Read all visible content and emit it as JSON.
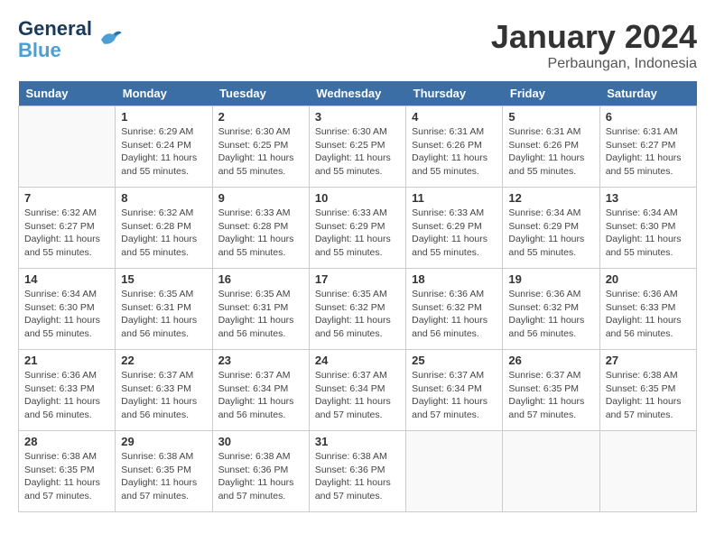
{
  "header": {
    "logo_line1": "General",
    "logo_line2": "Blue",
    "month": "January 2024",
    "location": "Perbaungan, Indonesia"
  },
  "weekdays": [
    "Sunday",
    "Monday",
    "Tuesday",
    "Wednesday",
    "Thursday",
    "Friday",
    "Saturday"
  ],
  "weeks": [
    [
      {
        "day": "",
        "info": ""
      },
      {
        "day": "1",
        "info": "Sunrise: 6:29 AM\nSunset: 6:24 PM\nDaylight: 11 hours\nand 55 minutes."
      },
      {
        "day": "2",
        "info": "Sunrise: 6:30 AM\nSunset: 6:25 PM\nDaylight: 11 hours\nand 55 minutes."
      },
      {
        "day": "3",
        "info": "Sunrise: 6:30 AM\nSunset: 6:25 PM\nDaylight: 11 hours\nand 55 minutes."
      },
      {
        "day": "4",
        "info": "Sunrise: 6:31 AM\nSunset: 6:26 PM\nDaylight: 11 hours\nand 55 minutes."
      },
      {
        "day": "5",
        "info": "Sunrise: 6:31 AM\nSunset: 6:26 PM\nDaylight: 11 hours\nand 55 minutes."
      },
      {
        "day": "6",
        "info": "Sunrise: 6:31 AM\nSunset: 6:27 PM\nDaylight: 11 hours\nand 55 minutes."
      }
    ],
    [
      {
        "day": "7",
        "info": "Sunrise: 6:32 AM\nSunset: 6:27 PM\nDaylight: 11 hours\nand 55 minutes."
      },
      {
        "day": "8",
        "info": "Sunrise: 6:32 AM\nSunset: 6:28 PM\nDaylight: 11 hours\nand 55 minutes."
      },
      {
        "day": "9",
        "info": "Sunrise: 6:33 AM\nSunset: 6:28 PM\nDaylight: 11 hours\nand 55 minutes."
      },
      {
        "day": "10",
        "info": "Sunrise: 6:33 AM\nSunset: 6:29 PM\nDaylight: 11 hours\nand 55 minutes."
      },
      {
        "day": "11",
        "info": "Sunrise: 6:33 AM\nSunset: 6:29 PM\nDaylight: 11 hours\nand 55 minutes."
      },
      {
        "day": "12",
        "info": "Sunrise: 6:34 AM\nSunset: 6:29 PM\nDaylight: 11 hours\nand 55 minutes."
      },
      {
        "day": "13",
        "info": "Sunrise: 6:34 AM\nSunset: 6:30 PM\nDaylight: 11 hours\nand 55 minutes."
      }
    ],
    [
      {
        "day": "14",
        "info": "Sunrise: 6:34 AM\nSunset: 6:30 PM\nDaylight: 11 hours\nand 55 minutes."
      },
      {
        "day": "15",
        "info": "Sunrise: 6:35 AM\nSunset: 6:31 PM\nDaylight: 11 hours\nand 56 minutes."
      },
      {
        "day": "16",
        "info": "Sunrise: 6:35 AM\nSunset: 6:31 PM\nDaylight: 11 hours\nand 56 minutes."
      },
      {
        "day": "17",
        "info": "Sunrise: 6:35 AM\nSunset: 6:32 PM\nDaylight: 11 hours\nand 56 minutes."
      },
      {
        "day": "18",
        "info": "Sunrise: 6:36 AM\nSunset: 6:32 PM\nDaylight: 11 hours\nand 56 minutes."
      },
      {
        "day": "19",
        "info": "Sunrise: 6:36 AM\nSunset: 6:32 PM\nDaylight: 11 hours\nand 56 minutes."
      },
      {
        "day": "20",
        "info": "Sunrise: 6:36 AM\nSunset: 6:33 PM\nDaylight: 11 hours\nand 56 minutes."
      }
    ],
    [
      {
        "day": "21",
        "info": "Sunrise: 6:36 AM\nSunset: 6:33 PM\nDaylight: 11 hours\nand 56 minutes."
      },
      {
        "day": "22",
        "info": "Sunrise: 6:37 AM\nSunset: 6:33 PM\nDaylight: 11 hours\nand 56 minutes."
      },
      {
        "day": "23",
        "info": "Sunrise: 6:37 AM\nSunset: 6:34 PM\nDaylight: 11 hours\nand 56 minutes."
      },
      {
        "day": "24",
        "info": "Sunrise: 6:37 AM\nSunset: 6:34 PM\nDaylight: 11 hours\nand 57 minutes."
      },
      {
        "day": "25",
        "info": "Sunrise: 6:37 AM\nSunset: 6:34 PM\nDaylight: 11 hours\nand 57 minutes."
      },
      {
        "day": "26",
        "info": "Sunrise: 6:37 AM\nSunset: 6:35 PM\nDaylight: 11 hours\nand 57 minutes."
      },
      {
        "day": "27",
        "info": "Sunrise: 6:38 AM\nSunset: 6:35 PM\nDaylight: 11 hours\nand 57 minutes."
      }
    ],
    [
      {
        "day": "28",
        "info": "Sunrise: 6:38 AM\nSunset: 6:35 PM\nDaylight: 11 hours\nand 57 minutes."
      },
      {
        "day": "29",
        "info": "Sunrise: 6:38 AM\nSunset: 6:35 PM\nDaylight: 11 hours\nand 57 minutes."
      },
      {
        "day": "30",
        "info": "Sunrise: 6:38 AM\nSunset: 6:36 PM\nDaylight: 11 hours\nand 57 minutes."
      },
      {
        "day": "31",
        "info": "Sunrise: 6:38 AM\nSunset: 6:36 PM\nDaylight: 11 hours\nand 57 minutes."
      },
      {
        "day": "",
        "info": ""
      },
      {
        "day": "",
        "info": ""
      },
      {
        "day": "",
        "info": ""
      }
    ]
  ]
}
